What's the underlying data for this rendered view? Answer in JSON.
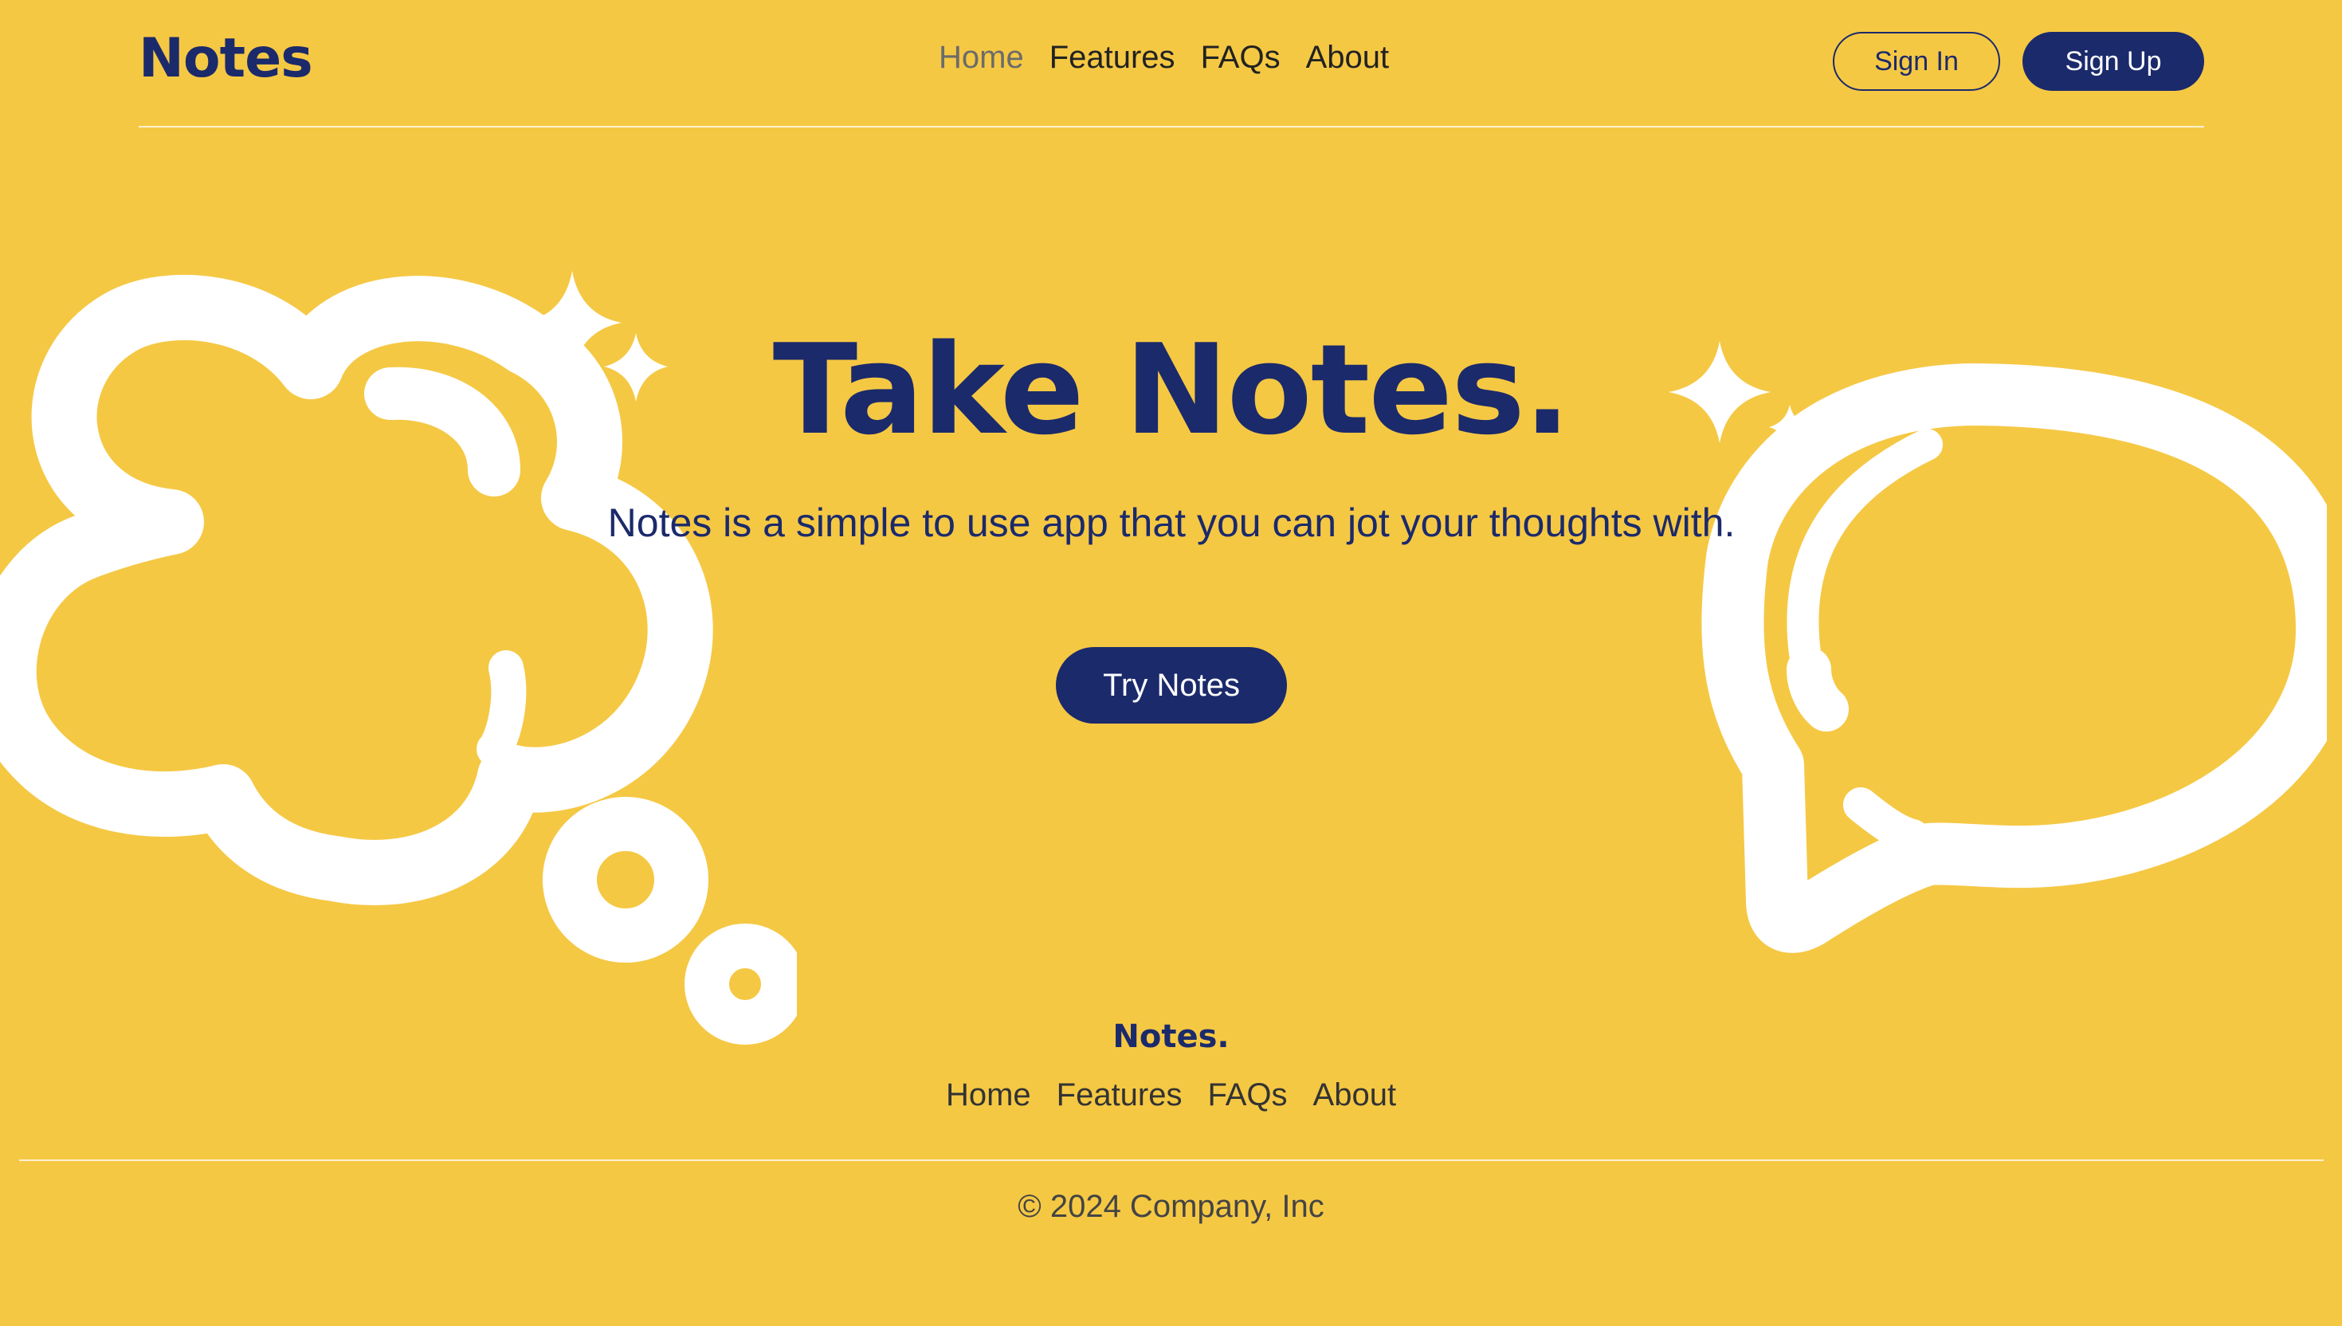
{
  "header": {
    "logo": "Notes",
    "nav": [
      {
        "label": "Home",
        "active": true
      },
      {
        "label": "Features",
        "active": false
      },
      {
        "label": "FAQs",
        "active": false
      },
      {
        "label": "About",
        "active": false
      }
    ],
    "sign_in_label": "Sign In",
    "sign_up_label": "Sign Up"
  },
  "hero": {
    "title": "Take Notes.",
    "subtitle": "Notes is a simple to use app that you can jot your thoughts with.",
    "cta_label": "Try Notes"
  },
  "footer": {
    "logo": "Notes.",
    "nav": [
      "Home",
      "Features",
      "FAQs",
      "About"
    ],
    "copyright": "© 2024 Company, Inc"
  },
  "colors": {
    "background": "#f5c844",
    "primary": "#1b2a6b",
    "decoration": "#ffffff"
  },
  "icons": {
    "left_decoration": "thought-cloud-icon",
    "right_decoration": "speech-bubble-icon",
    "sparkles": "sparkle-icon"
  }
}
